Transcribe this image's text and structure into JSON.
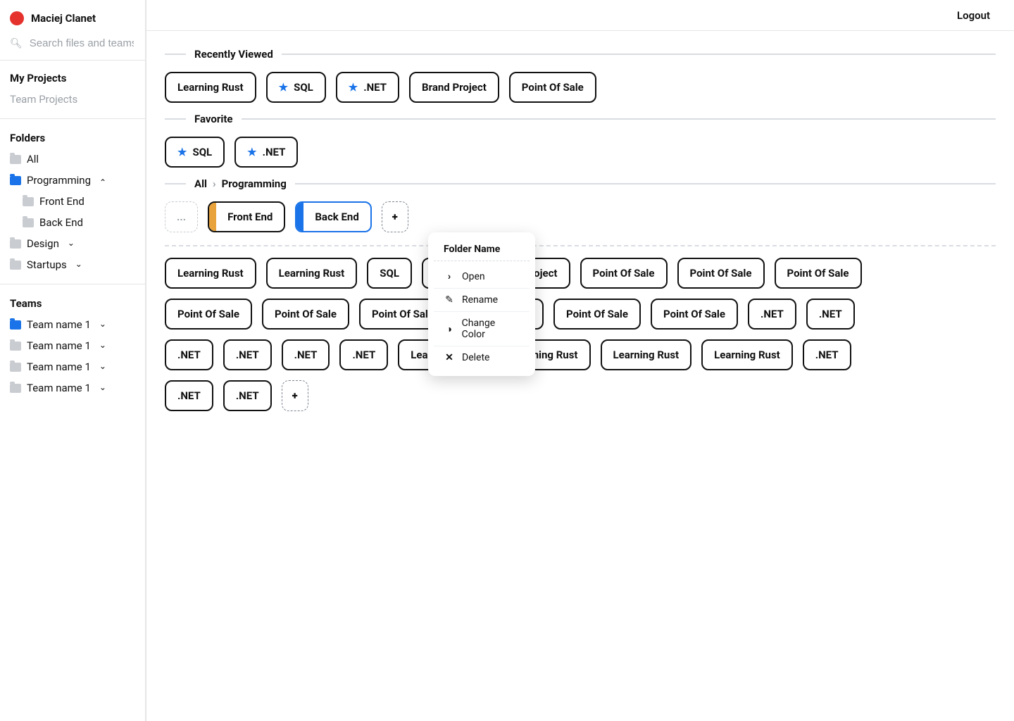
{
  "user": {
    "name": "Maciej Clanet"
  },
  "search": {
    "placeholder": "Search files and teams"
  },
  "topbar": {
    "logout": "Logout"
  },
  "nav": {
    "my_projects": "My Projects",
    "team_projects": "Team Projects"
  },
  "folders": {
    "heading": "Folders",
    "all": "All",
    "programming": "Programming",
    "front_end": "Front End",
    "back_end": "Back End",
    "design": "Design",
    "startups": "Startups"
  },
  "teams": {
    "heading": "Teams",
    "items": [
      "Team name 1",
      "Team name 1",
      "Team name 1",
      "Team name 1"
    ]
  },
  "sections": {
    "recently_viewed": "Recently Viewed",
    "favorite": "Favorite",
    "breadcrumb": {
      "root": "All",
      "current": "Programming"
    }
  },
  "recently_viewed": [
    {
      "label": "Learning Rust",
      "starred": false
    },
    {
      "label": "SQL",
      "starred": true
    },
    {
      "label": ".NET",
      "starred": true
    },
    {
      "label": "Brand Project",
      "starred": false
    },
    {
      "label": "Point Of Sale",
      "starred": false
    }
  ],
  "favorites": [
    {
      "label": "SQL",
      "starred": true
    },
    {
      "label": ".NET",
      "starred": true
    }
  ],
  "folder_chips": {
    "placeholder": "...",
    "front_end": "Front End",
    "back_end": "Back End",
    "add": "+"
  },
  "items_grid": [
    "Learning Rust",
    "Learning Rust",
    "SQL",
    ".NET",
    "Brand Project",
    "Point Of Sale",
    "Point Of Sale",
    "Point Of Sale",
    "Point Of Sale",
    "Point Of Sale",
    "Point Of Sale",
    "Point Of Sale",
    "Point Of Sale",
    "Point Of Sale",
    ".NET",
    ".NET",
    ".NET",
    ".NET",
    ".NET",
    ".NET",
    "Learning Rust",
    "Learning Rust",
    "Learning Rust",
    "Learning Rust",
    ".NET",
    ".NET",
    ".NET"
  ],
  "add_item": "+",
  "context_menu": {
    "title": "Folder Name",
    "open": "Open",
    "rename": "Rename",
    "change_color": "Change Color",
    "delete": "Delete"
  }
}
